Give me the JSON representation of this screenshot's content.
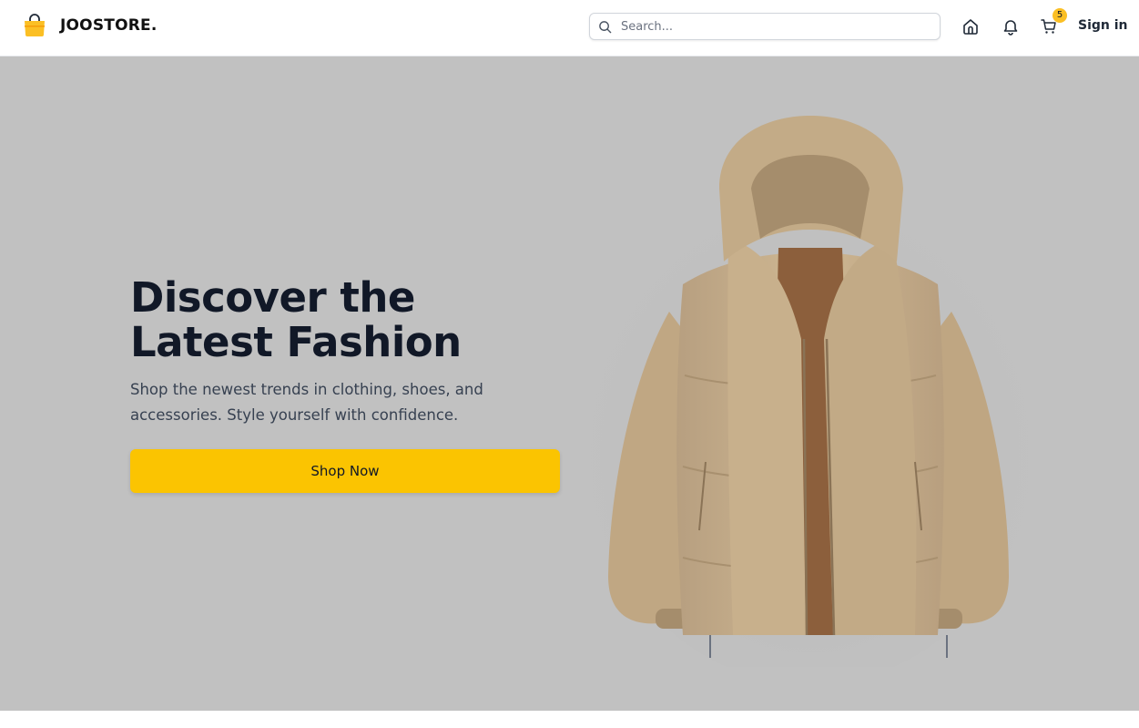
{
  "brand": {
    "name": "JOOSTORE.",
    "icon": "shopping-bag-icon",
    "accent_color": "#fbbf24"
  },
  "search": {
    "placeholder": "Search...",
    "value": ""
  },
  "nav": {
    "icons": [
      "home-icon",
      "bell-icon",
      "cart-icon"
    ],
    "cart_count": "5",
    "signin_label": "Sign in"
  },
  "hero": {
    "title": "Discover the Latest Fashion",
    "subtitle": "Shop the newest trends in clothing, shoes, and accessories. Style yourself with confidence.",
    "cta_label": "Shop Now",
    "background_color": "#c1c1c1",
    "button_color": "#fbc401",
    "image_subject": "jacket-image"
  }
}
